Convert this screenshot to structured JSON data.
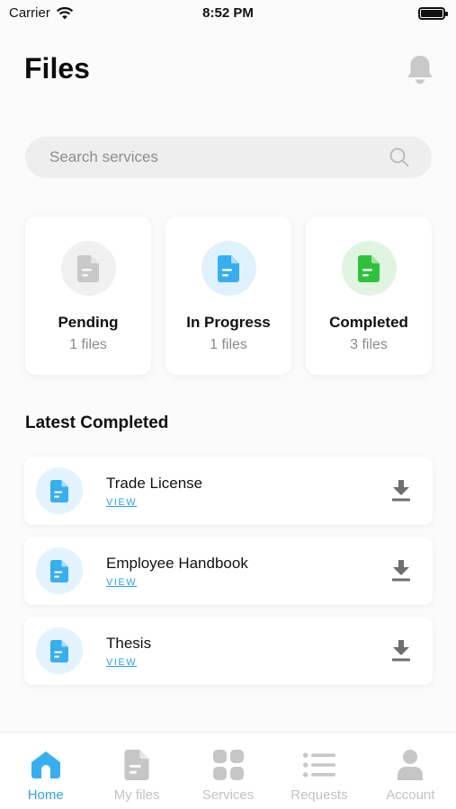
{
  "status_bar": {
    "carrier": "Carrier",
    "time": "8:52 PM"
  },
  "header": {
    "title": "Files",
    "icon": "bell-icon"
  },
  "search": {
    "placeholder": "Search services",
    "icon": "search-icon"
  },
  "summary_cards": [
    {
      "label": "Pending",
      "count": "1 files",
      "color": "#c8c8c8",
      "bg": "#f0f0f0"
    },
    {
      "label": "In Progress",
      "count": "1 files",
      "color": "#36aef0",
      "bg": "#dff1fd"
    },
    {
      "label": "Completed",
      "count": "3 files",
      "color": "#2fc13c",
      "bg": "#dff5e1"
    }
  ],
  "latest": {
    "title": "Latest Completed",
    "items": [
      {
        "name": "Trade License",
        "link": "VIEW"
      },
      {
        "name": "Employee Handbook",
        "link": "VIEW"
      },
      {
        "name": "Thesis",
        "link": "VIEW"
      }
    ]
  },
  "tabs": [
    {
      "label": "Home",
      "icon": "home-icon",
      "active": true
    },
    {
      "label": "My files",
      "icon": "file-icon",
      "active": false
    },
    {
      "label": "Services",
      "icon": "grid-icon",
      "active": false
    },
    {
      "label": "Requests",
      "icon": "list-icon",
      "active": false
    },
    {
      "label": "Account",
      "icon": "person-icon",
      "active": false
    }
  ],
  "colors": {
    "accent": "#2aa3e8",
    "inactive": "#c2c2c2"
  }
}
